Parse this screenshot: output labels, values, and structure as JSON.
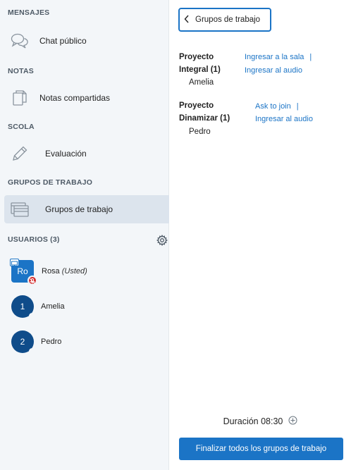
{
  "sidebar": {
    "sections": {
      "messages": "MENSAJES",
      "notes": "NOTAS",
      "scola": "SCOLA",
      "groups": "GRUPOS DE TRABAJO",
      "users": "USUARIOS (3)"
    },
    "items": {
      "public_chat": "Chat público",
      "shared_notes": "Notas compartidas",
      "evaluation": "Evaluación",
      "breakout_rooms": "Grupos de trabajo"
    },
    "users": [
      {
        "initials": "Ro",
        "name": "Rosa",
        "suffix": "(Usted)"
      },
      {
        "initials": "1",
        "name": "Amelia"
      },
      {
        "initials": "2",
        "name": "Pedro"
      }
    ]
  },
  "panel": {
    "back_label": "Grupos de trabajo",
    "rooms": [
      {
        "name_line1": "Proyecto",
        "name_line2": "Integral (1)",
        "link1": "Ingresar a la sala",
        "link2": "Ingresar al audio",
        "sep": "|",
        "user": "Amelia"
      },
      {
        "name_line1": "Proyecto",
        "name_line2": "Dinamizar (1)",
        "link1": "Ask to join",
        "link2": "Ingresar al audio",
        "sep": "|",
        "user": "Pedro"
      }
    ],
    "duration_label": "Duración 08:30",
    "end_all_label": "Finalizar todos los grupos de trabajo"
  },
  "colors": {
    "accent": "#1b74c6",
    "avatar_dark": "#0f4c8a",
    "sidebar_bg": "#f3f6f9",
    "active_bg": "#dce4ed"
  }
}
